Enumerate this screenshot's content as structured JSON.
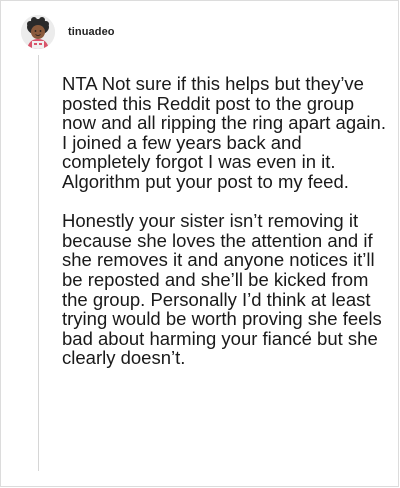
{
  "comment": {
    "username": "tinuadeo",
    "paragraphs": [
      "NTA Not sure if this helps but they’ve posted this Reddit post to the group now and all ripping the ring apart again. I joined a few years back and completely forgot I was even in it. Algorithm put your post to my feed.",
      "Honestly your sister isn’t removing it because she loves the attention and if she removes it and anyone notices it’ll be reposted and she’ll be kicked from the group. Personally I’d think at least trying would be worth proving she feels bad about harming your fiancé but she clearly doesn’t."
    ]
  }
}
